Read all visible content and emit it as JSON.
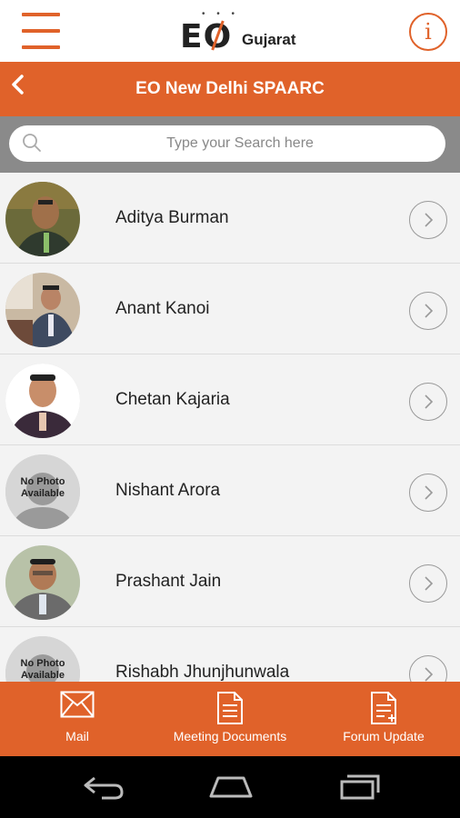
{
  "header": {
    "logo_text": "EO",
    "logo_region": "Gujarat",
    "info_glyph": "i"
  },
  "titlebar": {
    "back_glyph": "<",
    "title": "EO New Delhi SPAARC"
  },
  "search": {
    "placeholder": "Type your Search here",
    "value": ""
  },
  "members": [
    {
      "name": "Aditya Burman",
      "photo": "photo"
    },
    {
      "name": "Anant Kanoi",
      "photo": "photo"
    },
    {
      "name": "Chetan Kajaria",
      "photo": "photo"
    },
    {
      "name": "Nishant Arora",
      "photo": "no-photo",
      "no_photo_text": "No Photo Available"
    },
    {
      "name": "Prashant Jain",
      "photo": "photo"
    },
    {
      "name": "Rishabh Jhunjhunwala",
      "photo": "no-photo",
      "no_photo_text": "No Photo Available"
    }
  ],
  "bottom_tabs": [
    {
      "label": "Mail",
      "icon": "mail-icon"
    },
    {
      "label": "Meeting Documents",
      "icon": "document-icon"
    },
    {
      "label": "Forum Update",
      "icon": "document-edit-icon"
    }
  ],
  "colors": {
    "accent": "#e0622a",
    "search_band": "#8a8a8a",
    "list_bg": "#f3f3f3"
  }
}
